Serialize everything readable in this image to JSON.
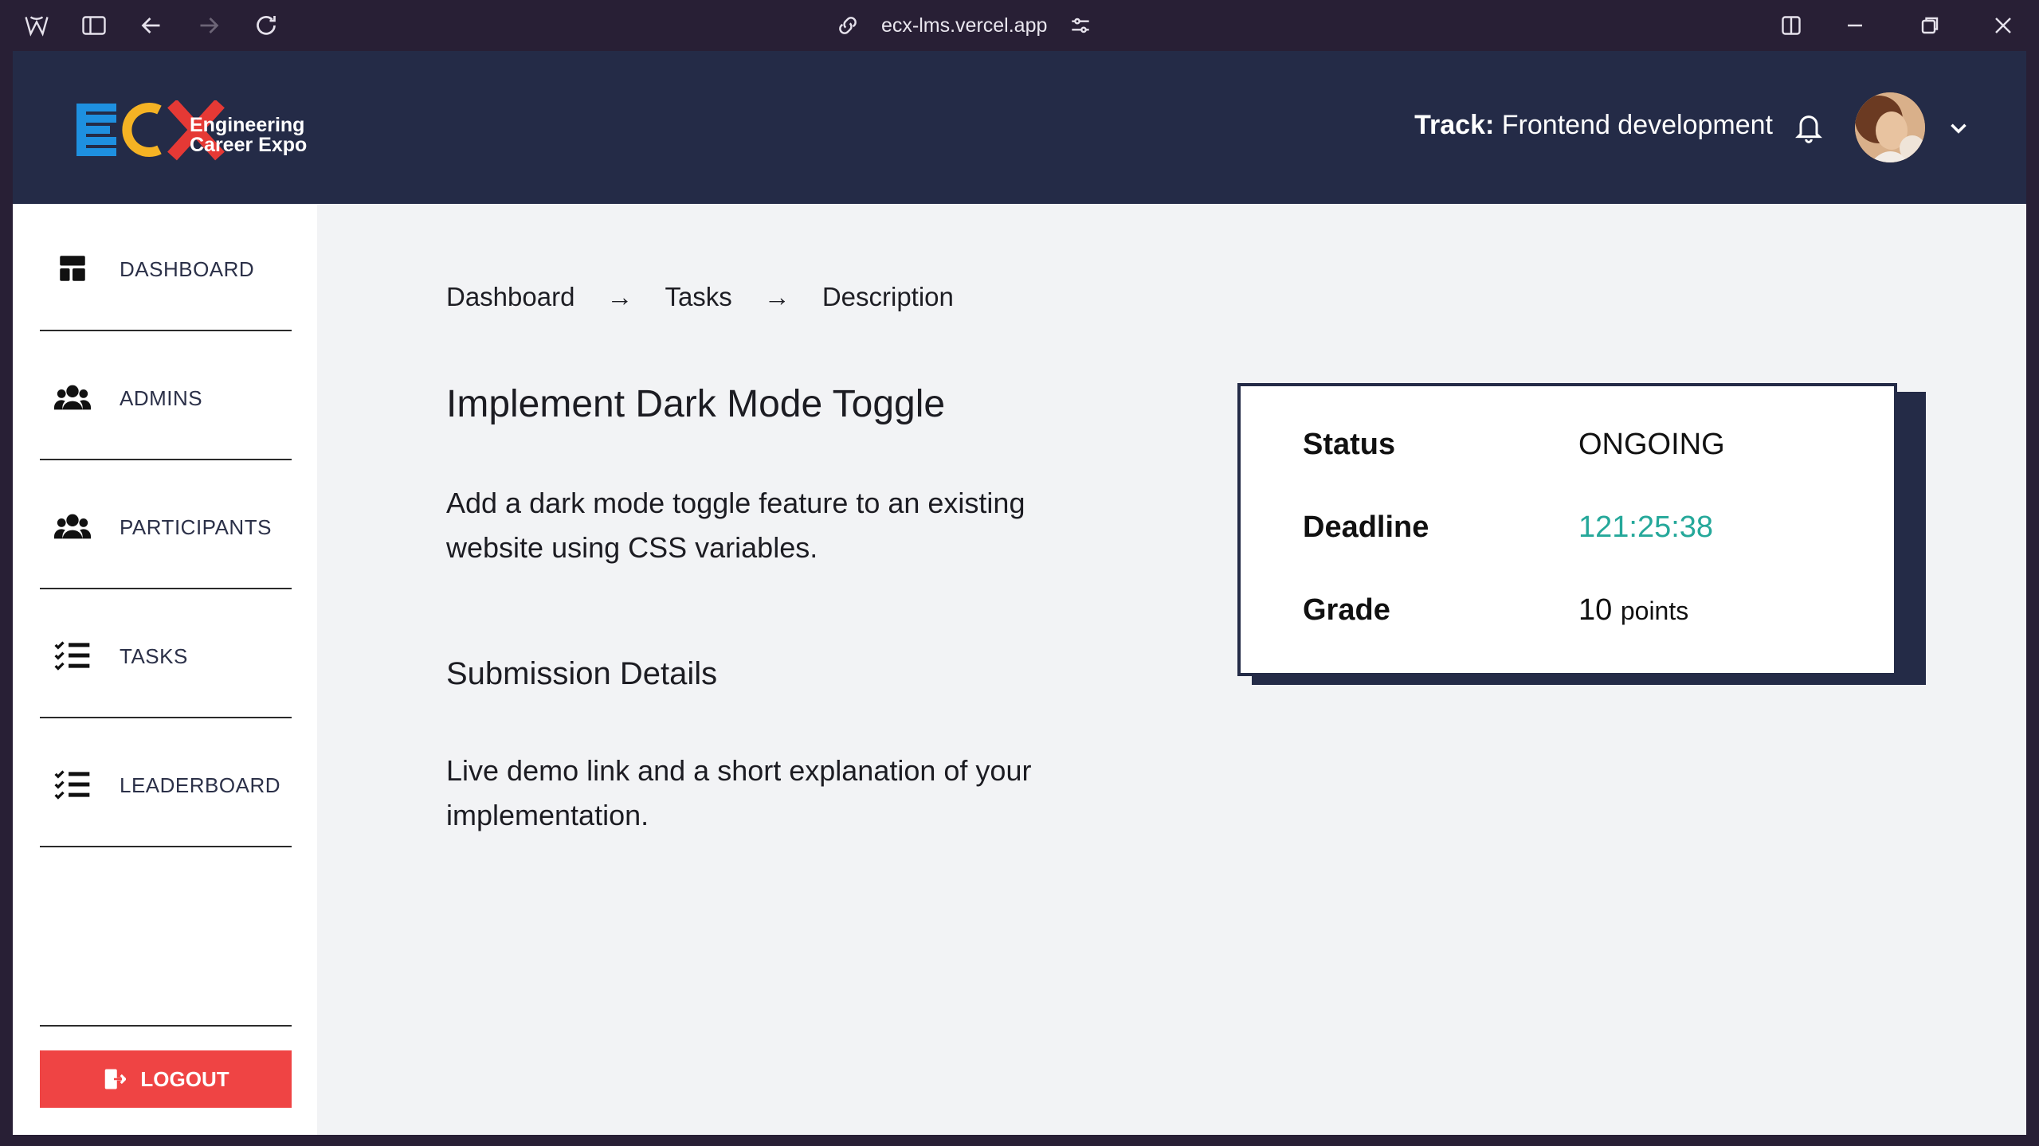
{
  "browser": {
    "url": "ecx-lms.vercel.app"
  },
  "header": {
    "logo_text_line1": "Engineering",
    "logo_text_line2": "Career Expo",
    "track_label": "Track:",
    "track_value": "Frontend development"
  },
  "sidebar": {
    "items": [
      {
        "label": "DASHBOARD",
        "icon": "dashboard-icon"
      },
      {
        "label": "ADMINS",
        "icon": "users-icon"
      },
      {
        "label": "PARTICIPANTS",
        "icon": "users-icon"
      },
      {
        "label": "TASKS",
        "icon": "checklist-icon"
      },
      {
        "label": "LEADERBOARD",
        "icon": "checklist-icon"
      }
    ],
    "logout_label": "LOGOUT"
  },
  "breadcrumb": {
    "items": [
      "Dashboard",
      "Tasks",
      "Description"
    ],
    "separator": "→"
  },
  "task": {
    "title": "Implement Dark Mode Toggle",
    "description": "Add a dark mode toggle feature to an existing website using CSS variables.",
    "submission_title": "Submission Details",
    "submission_description": "Live demo link and a short explanation of your implementation."
  },
  "info_card": {
    "status_label": "Status",
    "status_value": "ONGOING",
    "deadline_label": "Deadline",
    "deadline_value": "121:25:38",
    "grade_label": "Grade",
    "grade_value": "10",
    "grade_unit": "points"
  },
  "colors": {
    "header_bg": "#242b47",
    "logout_bg": "#ef4444",
    "deadline_color": "#25a89a",
    "logo_blue": "#1e90e0",
    "logo_yellow": "#f5b324",
    "logo_red": "#e53935"
  }
}
